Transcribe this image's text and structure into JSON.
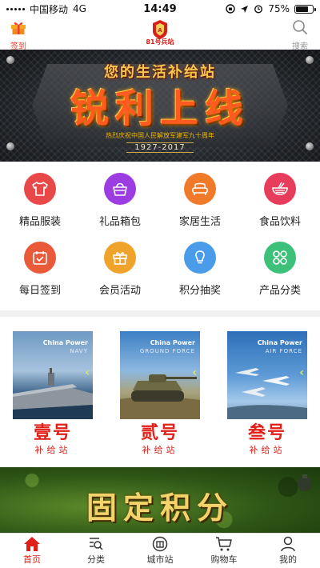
{
  "status_bar": {
    "carrier": "中国移动",
    "network": "4G",
    "time": "14:49",
    "battery": "75%",
    "battery_level": 0.75
  },
  "header": {
    "checkin_label": "签到",
    "logo_text": "81号兵站",
    "search_label": "搜索"
  },
  "banner": {
    "subtitle": "您的生活补给站",
    "title": "锐利上线",
    "caption": "热烈庆祝中国人民解放军建军九十周年",
    "years": "1927-2017"
  },
  "menu": [
    {
      "label": "精品服装",
      "icon": "tshirt-icon",
      "color": "#e94848"
    },
    {
      "label": "礼品箱包",
      "icon": "handbag-icon",
      "color": "#9b3de0"
    },
    {
      "label": "家居生活",
      "icon": "sofa-icon",
      "color": "#f07a2a"
    },
    {
      "label": "食品饮料",
      "icon": "noodle-bowl-icon",
      "color": "#e83c5c"
    },
    {
      "label": "每日签到",
      "icon": "calendar-icon",
      "color": "#e85a3a"
    },
    {
      "label": "会员活动",
      "icon": "gift-icon",
      "color": "#f0a32a"
    },
    {
      "label": "积分抽奖",
      "icon": "lightbulb-icon",
      "color": "#4a9be8"
    },
    {
      "label": "产品分类",
      "icon": "clover-icon",
      "color": "#3cc07a"
    }
  ],
  "cards": [
    {
      "brand": "China Power",
      "force": "NAVY",
      "number": "壹号",
      "sub": "补给站"
    },
    {
      "brand": "China Power",
      "force": "GROUND FORCE",
      "number": "贰号",
      "sub": "补给站"
    },
    {
      "brand": "China Power",
      "force": "AIR FORCE",
      "number": "叁号",
      "sub": "补给站"
    }
  ],
  "promo": {
    "title": "固定积分"
  },
  "tabbar": [
    {
      "label": "首页",
      "icon": "home-icon",
      "active": true
    },
    {
      "label": "分类",
      "icon": "category-search-icon",
      "active": false
    },
    {
      "label": "城市站",
      "icon": "city-station-icon",
      "active": false
    },
    {
      "label": "购物车",
      "icon": "cart-icon",
      "active": false
    },
    {
      "label": "我的",
      "icon": "person-icon",
      "active": false
    }
  ],
  "colors": {
    "accent": "#e02018",
    "checkin": "#e8412f"
  }
}
